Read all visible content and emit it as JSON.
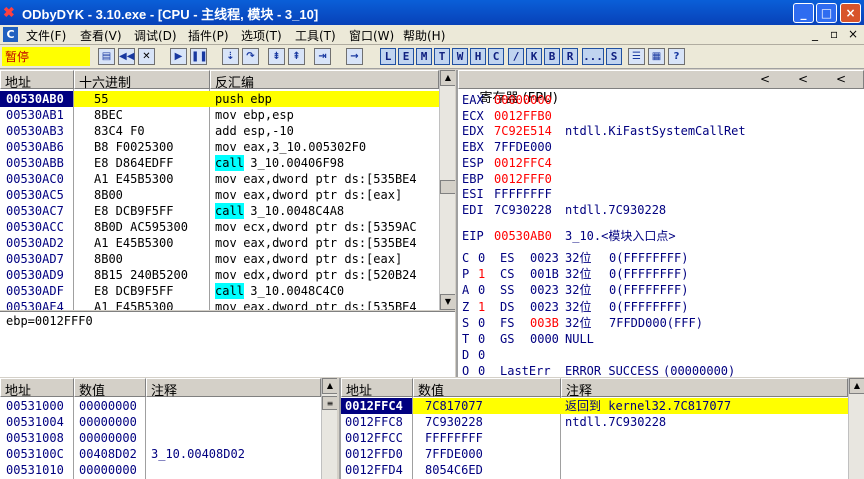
{
  "window": {
    "title": "ODbyDYK - 3.10.exe - [CPU - 主线程, 模块 - 3_10]",
    "btn_min": "_",
    "btn_max": "□",
    "btn_close": "×",
    "mdi_min": "_",
    "mdi_restore": "▫",
    "mdi_close": "×"
  },
  "menu": {
    "c_icon": "C",
    "items": [
      "文件(F)",
      "查看(V)",
      "调试(D)",
      "插件(P)",
      "选项(T)",
      "工具(T)",
      "窗口(W)",
      "帮助(H)"
    ]
  },
  "toolbar": {
    "status": "暂停",
    "letters": [
      "L",
      "E",
      "M",
      "T",
      "W",
      "H",
      "C",
      "/",
      "K",
      "B",
      "R",
      "...",
      "S"
    ]
  },
  "disasm": {
    "headers": {
      "addr": "地址",
      "hex": "十六进制",
      "asm": "反汇编"
    },
    "rows": [
      {
        "addr": "00530AB0",
        "hex": "55",
        "mn": "push",
        "ops": " ebp"
      },
      {
        "addr": "00530AB1",
        "hex": "8BEC",
        "mn": "mov",
        "ops": " ebp,esp"
      },
      {
        "addr": "00530AB3",
        "hex": "83C4 F0",
        "mn": "add",
        "ops": " esp,-10"
      },
      {
        "addr": "00530AB6",
        "hex": "B8 F0025300",
        "mn": "mov",
        "ops": " eax,3_10.005302F0"
      },
      {
        "addr": "00530ABB",
        "hex": "E8 D864EDFF",
        "mn": "call",
        "ops": " 3_10.00406F98"
      },
      {
        "addr": "00530AC0",
        "hex": "A1 E45B5300",
        "mn": "mov",
        "ops": " eax,dword ptr ds:[535BE4"
      },
      {
        "addr": "00530AC5",
        "hex": "8B00",
        "mn": "mov",
        "ops": " eax,dword ptr ds:[eax]"
      },
      {
        "addr": "00530AC7",
        "hex": "E8 DCB9F5FF",
        "mn": "call",
        "ops": " 3_10.0048C4A8"
      },
      {
        "addr": "00530ACC",
        "hex": "8B0D AC595300",
        "mn": "mov",
        "ops": " ecx,dword ptr ds:[5359AC"
      },
      {
        "addr": "00530AD2",
        "hex": "A1 E45B5300",
        "mn": "mov",
        "ops": " eax,dword ptr ds:[535BE4"
      },
      {
        "addr": "00530AD7",
        "hex": "8B00",
        "mn": "mov",
        "ops": " eax,dword ptr ds:[eax]"
      },
      {
        "addr": "00530AD9",
        "hex": "8B15 240B5200",
        "mn": "mov",
        "ops": " edx,dword ptr ds:[520B24"
      },
      {
        "addr": "00530ADF",
        "hex": "E8 DCB9F5FF",
        "mn": "call",
        "ops": " 3_10.0048C4C0"
      },
      {
        "addr": "00530AE4",
        "hex": "A1 E45B5300",
        "mn": "mov",
        "ops": " eax,dword ptr ds:[535BE4"
      }
    ],
    "info": "ebp=0012FFF0"
  },
  "registers": {
    "title": "寄存器 (FPU)",
    "nav": [
      "<",
      "<",
      "<"
    ],
    "gp": [
      {
        "name": "EAX",
        "val": "00000000",
        "red": true,
        "comment": ""
      },
      {
        "name": "ECX",
        "val": "0012FFB0",
        "red": true,
        "comment": ""
      },
      {
        "name": "EDX",
        "val": "7C92E514",
        "red": true,
        "comment": "ntdll.KiFastSystemCallRet"
      },
      {
        "name": "EBX",
        "val": "7FFDE000",
        "red": false,
        "comment": ""
      },
      {
        "name": "ESP",
        "val": "0012FFC4",
        "red": true,
        "comment": ""
      },
      {
        "name": "EBP",
        "val": "0012FFF0",
        "red": true,
        "comment": ""
      },
      {
        "name": "ESI",
        "val": "FFFFFFFF",
        "red": false,
        "comment": ""
      },
      {
        "name": "EDI",
        "val": "7C930228",
        "red": false,
        "comment": "ntdll.7C930228"
      }
    ],
    "eip": {
      "name": "EIP",
      "val": "00530AB0",
      "comment": "3_10.<模块入口点>"
    },
    "flags": [
      {
        "f": "C",
        "v": "0",
        "red": false,
        "seg": "ES",
        "sel": "0023",
        "selred": false,
        "bits": "32位",
        "desc": "0(FFFFFFFF)"
      },
      {
        "f": "P",
        "v": "1",
        "red": true,
        "seg": "CS",
        "sel": "001B",
        "selred": false,
        "bits": "32位",
        "desc": "0(FFFFFFFF)"
      },
      {
        "f": "A",
        "v": "0",
        "red": false,
        "seg": "SS",
        "sel": "0023",
        "selred": false,
        "bits": "32位",
        "desc": "0(FFFFFFFF)"
      },
      {
        "f": "Z",
        "v": "1",
        "red": true,
        "seg": "DS",
        "sel": "0023",
        "selred": false,
        "bits": "32位",
        "desc": "0(FFFFFFFF)"
      },
      {
        "f": "S",
        "v": "0",
        "red": false,
        "seg": "FS",
        "sel": "003B",
        "selred": true,
        "bits": "32位",
        "desc": "7FFDD000(FFF)"
      },
      {
        "f": "T",
        "v": "0",
        "red": false,
        "seg": "GS",
        "sel": "0000",
        "selred": false,
        "bits": "NULL",
        "desc": ""
      },
      {
        "f": "D",
        "v": "0",
        "red": false,
        "seg": "",
        "sel": "",
        "selred": false,
        "bits": "",
        "desc": ""
      },
      {
        "f": "O",
        "v": "0",
        "red": false,
        "seg": "LastErr",
        "sel": "ERROR_SUCCESS",
        "selred": false,
        "bits": "(00000000)",
        "desc": ""
      }
    ]
  },
  "dump": {
    "headers": {
      "addr": "地址",
      "val": "数值",
      "comment": "注释"
    },
    "rows": [
      {
        "addr": "00531000",
        "val": "00000000",
        "comment": ""
      },
      {
        "addr": "00531004",
        "val": "00000000",
        "comment": ""
      },
      {
        "addr": "00531008",
        "val": "00000000",
        "comment": ""
      },
      {
        "addr": "0053100C",
        "val": "00408D02",
        "comment": "3_10.00408D02"
      },
      {
        "addr": "00531010",
        "val": "00000000",
        "comment": ""
      }
    ]
  },
  "stack": {
    "headers": {
      "addr": "地址",
      "val": "数值",
      "comment": "注释"
    },
    "rows": [
      {
        "addr": "0012FFC4",
        "val": "7C817077",
        "comment": "返回到 kernel32.7C817077"
      },
      {
        "addr": "0012FFC8",
        "val": "7C930228",
        "comment": "ntdll.7C930228"
      },
      {
        "addr": "0012FFCC",
        "val": "FFFFFFFF",
        "comment": ""
      },
      {
        "addr": "0012FFD0",
        "val": "7FFDE000",
        "comment": ""
      },
      {
        "addr": "0012FFD4",
        "val": "8054C6ED",
        "comment": ""
      }
    ]
  }
}
